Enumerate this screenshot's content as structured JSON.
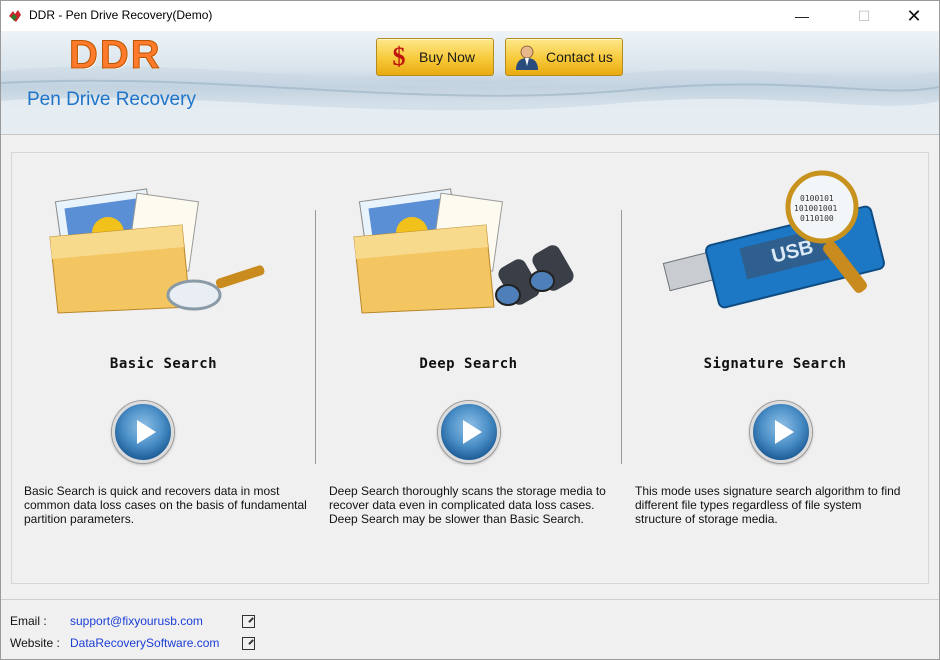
{
  "window": {
    "title": "DDR - Pen Drive Recovery(Demo)",
    "minimize_glyph": "—",
    "maximize_glyph": "☐",
    "close_glyph": "✕"
  },
  "banner": {
    "logo": "DDR",
    "subtitle": "Pen Drive Recovery",
    "buy_now_label": "Buy  Now",
    "buy_icon_glyph": "$",
    "contact_label": "Contact us"
  },
  "modes": [
    {
      "title": "Basic Search",
      "icon": "folder-magnifier-icon",
      "description": [
        "Basic Search is quick and recovers data in most",
        "common data loss cases on the basis of fundamental",
        "partition parameters."
      ]
    },
    {
      "title": "Deep Search",
      "icon": "folder-binoculars-icon",
      "description": [
        "Deep Search thoroughly scans the storage media to",
        "recover data even in complicated data loss cases.",
        "Deep Search may be slower than Basic Search."
      ]
    },
    {
      "title": "Signature Search",
      "icon": "usb-magnifier-icon",
      "description": [
        "This mode uses signature search algorithm to find",
        "different file types regardless of file system",
        "structure of storage media."
      ]
    }
  ],
  "footer": {
    "email_label": "Email :",
    "email_value": "support@fixyourusb.com",
    "website_label": "Website :",
    "website_value": "DataRecoverySoftware.com"
  },
  "colors": {
    "logo": "#ff7a2a",
    "subtitle": "#1e74c8",
    "link": "#1a3dd6",
    "button_gold": "#f7c93a"
  }
}
